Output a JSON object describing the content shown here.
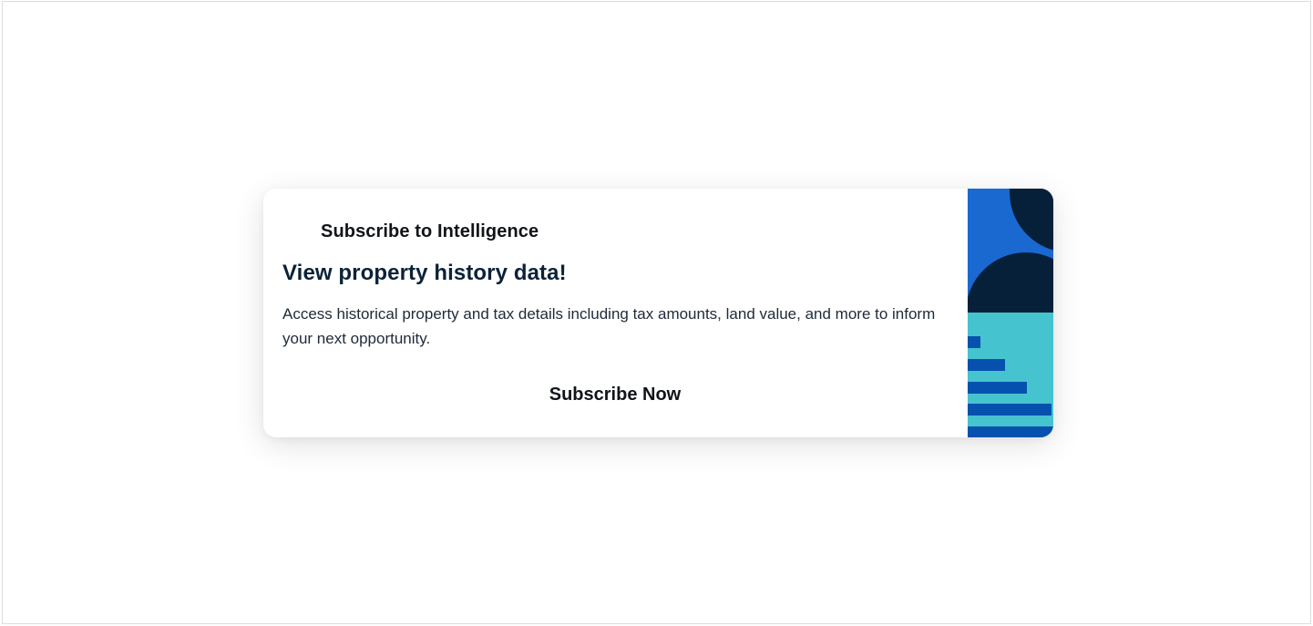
{
  "promo": {
    "eyebrow": "Subscribe to Intelligence",
    "headline": "View property history data!",
    "body": "Access historical property and tax details including tax amounts, land value, and more to inform your next opportunity.",
    "cta_label": "Subscribe Now"
  },
  "colors": {
    "frame_border": "#dcdcdc",
    "headline": "#0b2238",
    "art_blue": "#1a69d1",
    "art_navy": "#062039",
    "art_teal": "#45c3ce",
    "art_bar": "#0651ae"
  }
}
